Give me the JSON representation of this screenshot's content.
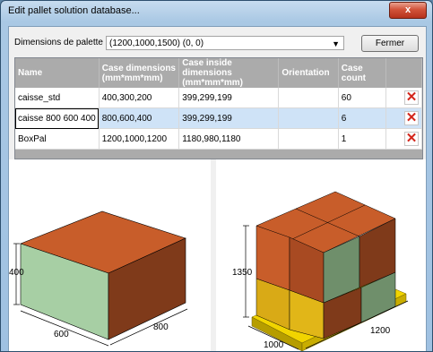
{
  "window": {
    "title": "Edit pallet solution database...",
    "close_glyph": "x"
  },
  "controls": {
    "dimension_label": "Dimensions de palette",
    "dimension_value": "(1200,1000,1500) (0, 0)",
    "close_button": "Fermer"
  },
  "grid": {
    "columns": [
      {
        "name": "Name",
        "width": 72
      },
      {
        "name": "Case dimensions (mm*mm*mm)",
        "width": 92
      },
      {
        "name": "Case inside dimensions (mm*mm*mm)",
        "width": 120
      },
      {
        "name": "Orientation",
        "width": 68
      },
      {
        "name": "Case count",
        "width": 58
      },
      {
        "name": "",
        "width": 44
      }
    ],
    "rows": [
      {
        "name": "caisse_std",
        "dims": "400,300,200",
        "inside": "399,299,199",
        "orientation": "",
        "count": "60",
        "selected": false
      },
      {
        "name": "caisse 800 600 400",
        "dims": "800,600,400",
        "inside": "399,299,199",
        "orientation": "",
        "count": "6",
        "selected": true
      },
      {
        "name": "BoxPal",
        "dims": "1200,1000,1200",
        "inside": "1180,980,1180",
        "orientation": "",
        "count": "1",
        "selected": false
      }
    ],
    "delete_icon": "red-x-icon"
  },
  "left_view": {
    "dim_height": "400",
    "dim_width": "600",
    "dim_depth": "800"
  },
  "right_view": {
    "dim_height": "1350",
    "dim_width": "1000",
    "dim_depth": "1200"
  },
  "colors": {
    "box_top": "#c85d2a",
    "box_front": "#a7cfa4",
    "box_side": "#7f3a1a",
    "pallet": "#f1d400",
    "pallet_dark": "#b69d00",
    "yellow_box": "#d9aa16",
    "yellow_box_dark": "#a98210"
  }
}
